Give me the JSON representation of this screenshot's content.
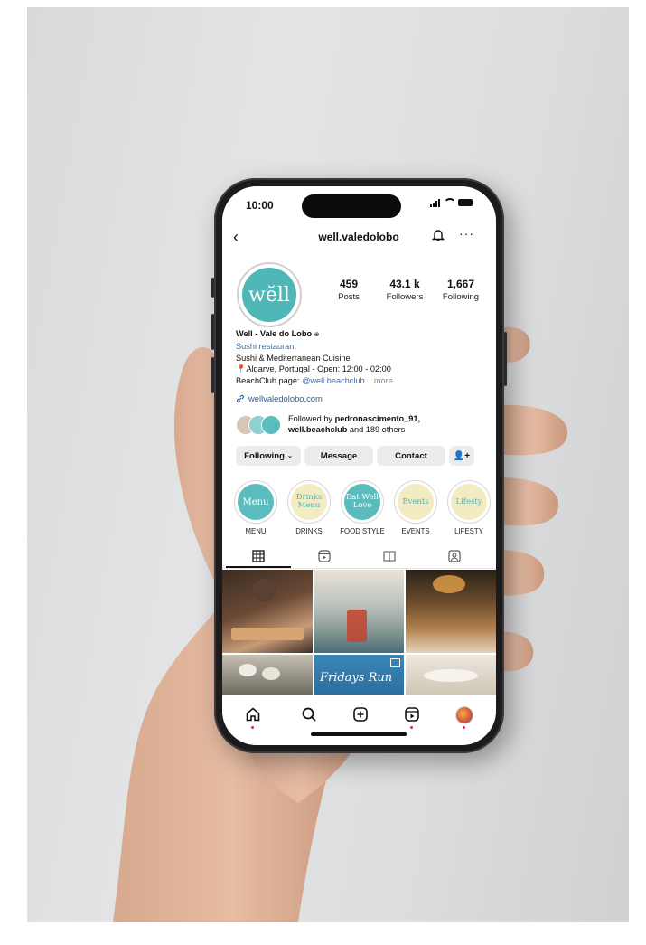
{
  "status": {
    "time": "10:00"
  },
  "header": {
    "username": "well.valedolobo",
    "back_icon": "‹",
    "more_icon": "···"
  },
  "profile": {
    "avatar_text": "wĕll",
    "stats": [
      {
        "value": "459",
        "label": "Posts"
      },
      {
        "value": "43.1 k",
        "label": "Followers"
      },
      {
        "value": "1,667",
        "label": "Following"
      }
    ],
    "name": "Well - Vale do Lobo",
    "category": "Sushi restaurant",
    "bio_line1": "Sushi & Mediterranean Cuisine",
    "bio_line2": "Algarve, Portugal - Open: 12:00 - 02:00",
    "bio_line3_prefix": "BeachClub page:",
    "bio_line3_handle": "@well.beachclub",
    "bio_more": "... more",
    "link": "wellvaledolobo.com",
    "followed_prefix": "Followed by",
    "followed_user1": "pedronascimento_91,",
    "followed_user2": "well.beachclub",
    "followed_suffix": "and 189 others"
  },
  "buttons": {
    "following": "Following",
    "message": "Message",
    "contact": "Contact"
  },
  "highlights": [
    {
      "label": "MENU",
      "text": "Menu",
      "bg": "#5bbcbd",
      "fg": "#ffffff"
    },
    {
      "label": "DRINKS",
      "text": "Drinks Menu",
      "bg": "#f3ecc2",
      "fg": "#4fb2b3"
    },
    {
      "label": "FOOD STYLE",
      "text": "Eat Well Love",
      "bg": "#5bbcbd",
      "fg": "#ffffff"
    },
    {
      "label": "EVENTS",
      "text": "Events",
      "bg": "#f3ecc2",
      "fg": "#4fb2b3"
    },
    {
      "label": "LIFESTY",
      "text": "Lifesty",
      "bg": "#f3ecc2",
      "fg": "#4fb2b3"
    }
  ],
  "grid": {
    "post_text": "Fridays Run"
  },
  "colors": {
    "accent": "#4fb7b8",
    "link": "#3a6fa8",
    "button_bg": "#ececec"
  }
}
